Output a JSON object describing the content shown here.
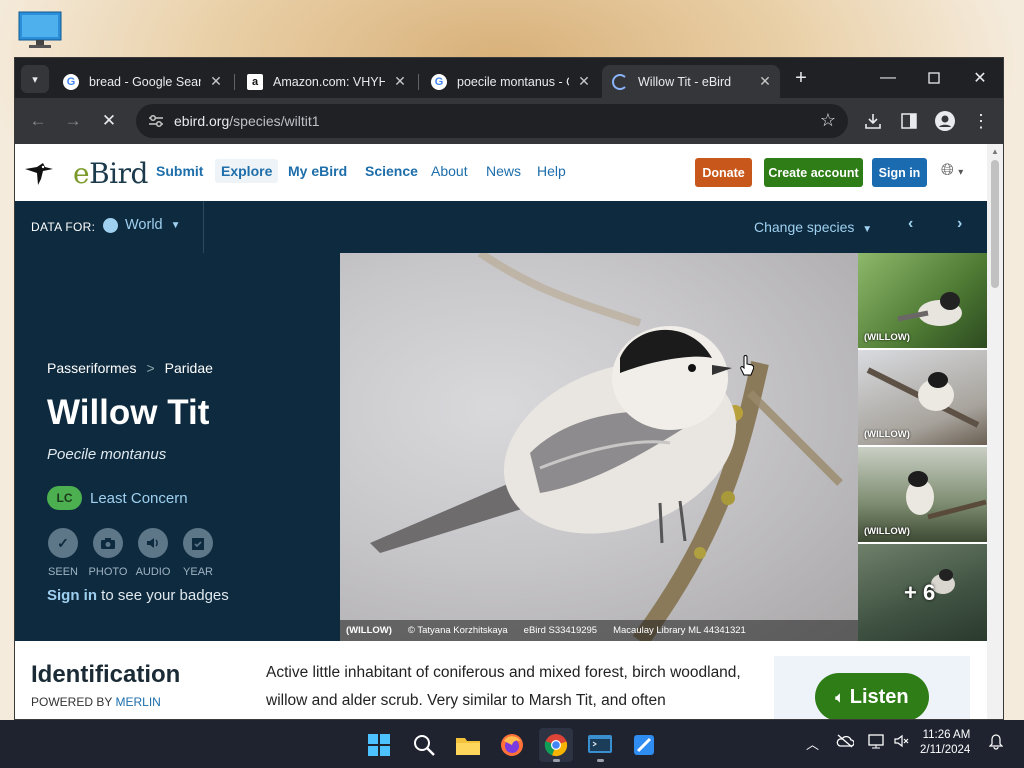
{
  "browser": {
    "tabs": [
      {
        "title": "bread - Google Searc",
        "icon": "google-icon"
      },
      {
        "title": "Amazon.com: VHYHC",
        "icon": "amazon-icon"
      },
      {
        "title": "poecile montanus - G",
        "icon": "google-icon"
      },
      {
        "title": "Willow Tit - eBird",
        "icon": "loading-icon",
        "active": true
      }
    ],
    "url_host": "ebird.org",
    "url_path": "/species/wiltit1"
  },
  "site": {
    "logo": "eBird",
    "nav": [
      "Submit",
      "Explore",
      "My eBird",
      "Science",
      "About",
      "News",
      "Help"
    ],
    "donate": "Donate",
    "create_account": "Create account",
    "sign_in": "Sign in",
    "colors": {
      "donate": "#c8571b",
      "create": "#2e7d16",
      "signin": "#1a6bb0",
      "navy": "#0e2a3e"
    }
  },
  "databar": {
    "label": "DATA FOR:",
    "region": "World",
    "change": "Change species"
  },
  "species": {
    "order": "Passeriformes",
    "family": "Paridae",
    "crumb_sep": ">",
    "common_name": "Willow Tit",
    "scientific_name": "Poecile montanus",
    "status_code": "LC",
    "status_label": "Least Concern",
    "badges": [
      "SEEN",
      "PHOTO",
      "AUDIO",
      "YEAR"
    ],
    "sign_in_link": "Sign in",
    "sign_in_rest": "to see your badges"
  },
  "photo": {
    "tag": "(WILLOW)",
    "credit": "© Tatyana Korzhitskaya",
    "checklist": "eBird S33419295",
    "asset": "Macaulay Library ML 44341321"
  },
  "thumbs": [
    "(WILLOW)",
    "(WILLOW)",
    "(WILLOW)"
  ],
  "more_count": "+ 6",
  "identification": {
    "heading": "Identification",
    "powered": "POWERED BY",
    "merlin": "MERLIN",
    "desc": "Active little inhabitant of coniferous and mixed forest, birch woodland, willow and alder scrub. Very similar to Marsh Tit, and often",
    "listen": "Listen"
  },
  "taskbar": {
    "time": "11:26 AM",
    "date": "2/11/2024"
  }
}
